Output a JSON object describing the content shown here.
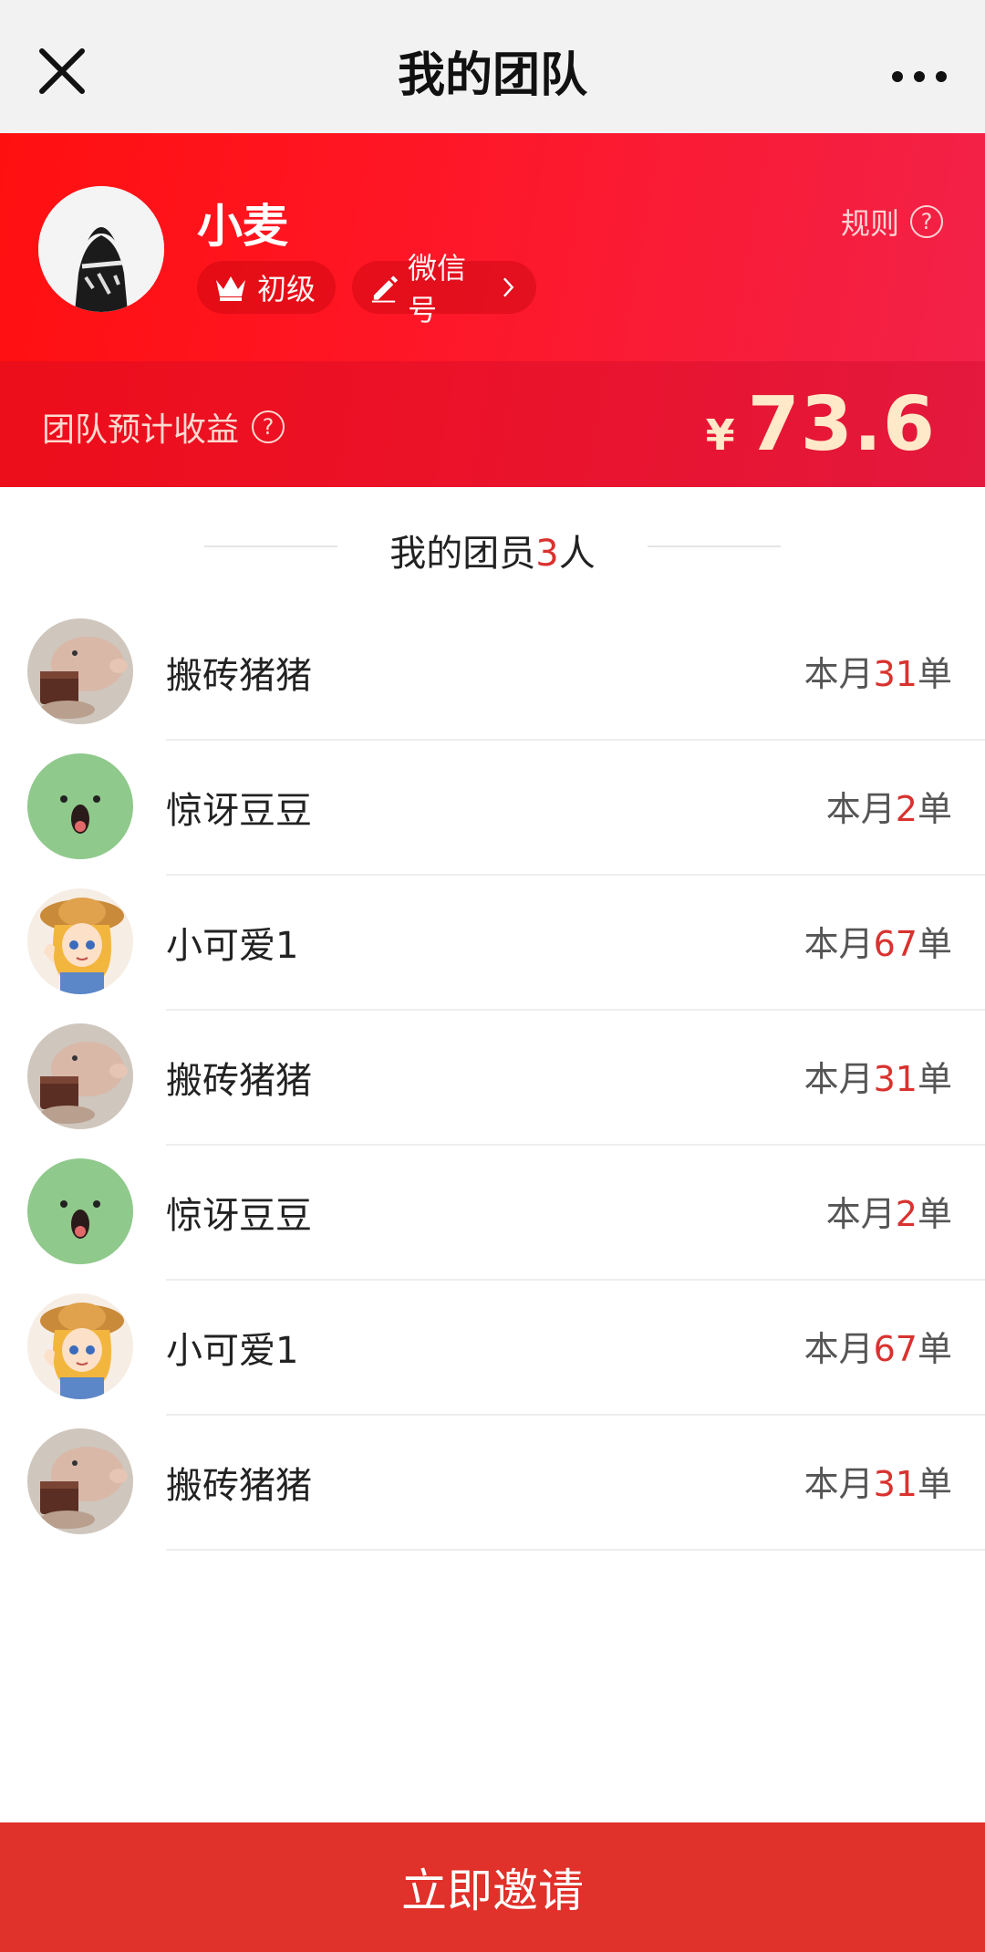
{
  "navbar": {
    "title": "我的团队",
    "close_icon": "close-icon",
    "more_icon": "more-icon"
  },
  "profile": {
    "name": "小麦",
    "level_label": "初级",
    "wechat_label": "微信号",
    "rules_label": "规则"
  },
  "earnings": {
    "label": "团队预计收益",
    "currency": "¥",
    "amount": "73.6"
  },
  "members_section": {
    "prefix": "我的团员",
    "count": "3",
    "suffix": "人"
  },
  "members": [
    {
      "name": "搬砖猪猪",
      "orders_prefix": "本月",
      "orders": "31",
      "orders_suffix": "单",
      "avatar": "pig-avatar"
    },
    {
      "name": "惊讶豆豆",
      "orders_prefix": "本月",
      "orders": "2",
      "orders_suffix": "单",
      "avatar": "green-face-avatar"
    },
    {
      "name": "小可爱1",
      "orders_prefix": "本月",
      "orders": "67",
      "orders_suffix": "单",
      "avatar": "girl-avatar"
    },
    {
      "name": "搬砖猪猪",
      "orders_prefix": "本月",
      "orders": "31",
      "orders_suffix": "单",
      "avatar": "pig-avatar"
    },
    {
      "name": "惊讶豆豆",
      "orders_prefix": "本月",
      "orders": "2",
      "orders_suffix": "单",
      "avatar": "green-face-avatar"
    },
    {
      "name": "小可爱1",
      "orders_prefix": "本月",
      "orders": "67",
      "orders_suffix": "单",
      "avatar": "girl-avatar"
    },
    {
      "name": "搬砖猪猪",
      "orders_prefix": "本月",
      "orders": "31",
      "orders_suffix": "单",
      "avatar": "pig-avatar"
    }
  ],
  "cta": {
    "invite_label": "立即邀请"
  },
  "colors": {
    "accent_red": "#e0312a",
    "highlight_number": "#d9322f",
    "header_gradient_start": "#ff1010",
    "header_gradient_end": "#f2224a",
    "earnings_gold": "#ffe9c9"
  }
}
